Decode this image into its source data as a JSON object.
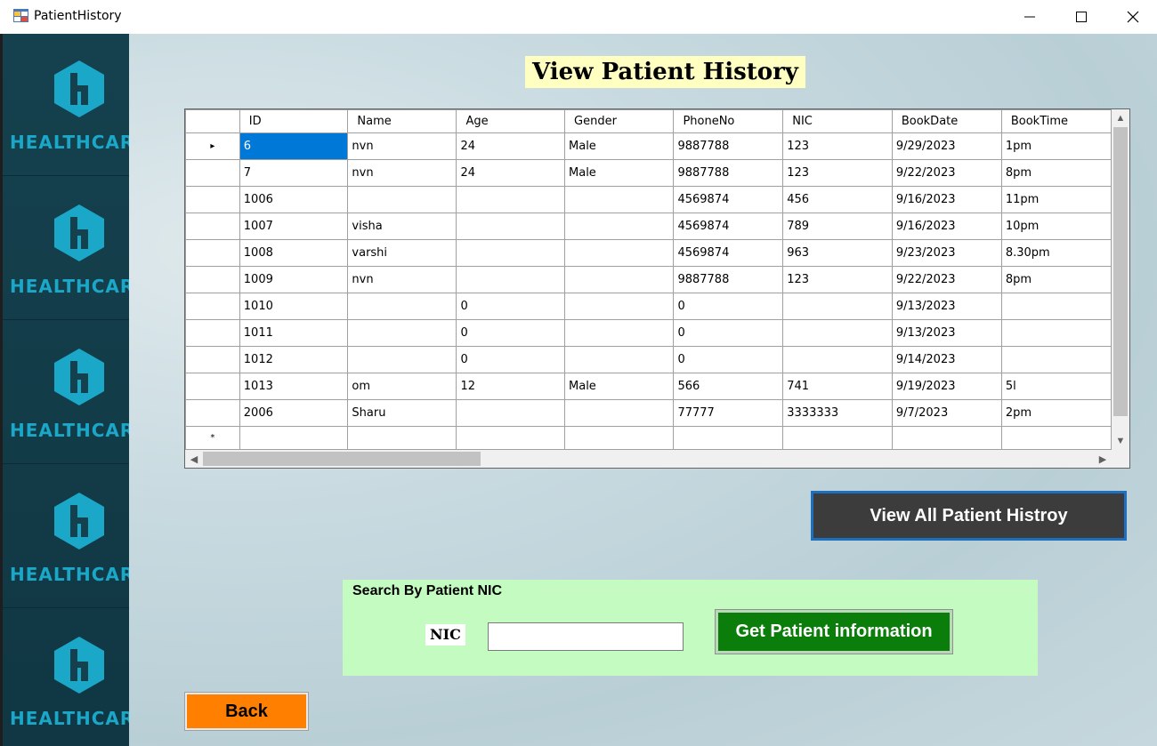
{
  "window": {
    "title": "PatientHistory",
    "controls": [
      "minimize-icon",
      "maximize-icon",
      "close-icon"
    ]
  },
  "sidebar": {
    "brand_text": "HEALTHCARE",
    "logo_icon": "healthcare-h-logo-icon",
    "logo_color": "#1aa7c8",
    "background": "#15414e"
  },
  "page": {
    "title": "View Patient History"
  },
  "grid": {
    "columns": [
      "ID",
      "Name",
      "Age",
      "Gender",
      "PhoneNo",
      "NIC",
      "BookDate",
      "BookTime"
    ],
    "rows": [
      [
        "6",
        "nvn",
        "24",
        "Male",
        "9887788",
        "123",
        "9/29/2023",
        "1pm"
      ],
      [
        "7",
        "nvn",
        "24",
        "Male",
        "9887788",
        "123",
        "9/22/2023",
        "8pm"
      ],
      [
        "1006",
        "",
        "",
        "",
        "4569874",
        "456",
        "9/16/2023",
        "11pm"
      ],
      [
        "1007",
        "visha",
        "",
        "",
        "4569874",
        "789",
        "9/16/2023",
        "10pm"
      ],
      [
        "1008",
        "varshi",
        "",
        "",
        "4569874",
        "963",
        "9/23/2023",
        "8.30pm"
      ],
      [
        "1009",
        "nvn",
        "",
        "",
        "9887788",
        "123",
        "9/22/2023",
        "8pm"
      ],
      [
        "1010",
        "",
        "0",
        "",
        "0",
        "",
        "9/13/2023",
        ""
      ],
      [
        "1011",
        "",
        "0",
        "",
        "0",
        "",
        "9/13/2023",
        ""
      ],
      [
        "1012",
        "",
        "0",
        "",
        "0",
        "",
        "9/14/2023",
        ""
      ],
      [
        "1013",
        "om",
        "12",
        "Male",
        "566",
        "741",
        "9/19/2023",
        "5l"
      ],
      [
        "2006",
        "Sharu",
        "",
        "",
        "77777",
        "3333333",
        "9/7/2023",
        "2pm"
      ]
    ],
    "current_row_marker": "▸",
    "new_row_marker": "*",
    "selection_color": "#0078d7"
  },
  "buttons": {
    "view_all": "View All Patient Histroy",
    "get_info": "Get  Patient information",
    "back": "Back"
  },
  "search": {
    "group_title": "Search By Patient NIC",
    "nic_label": "NIC",
    "nic_value": ""
  }
}
